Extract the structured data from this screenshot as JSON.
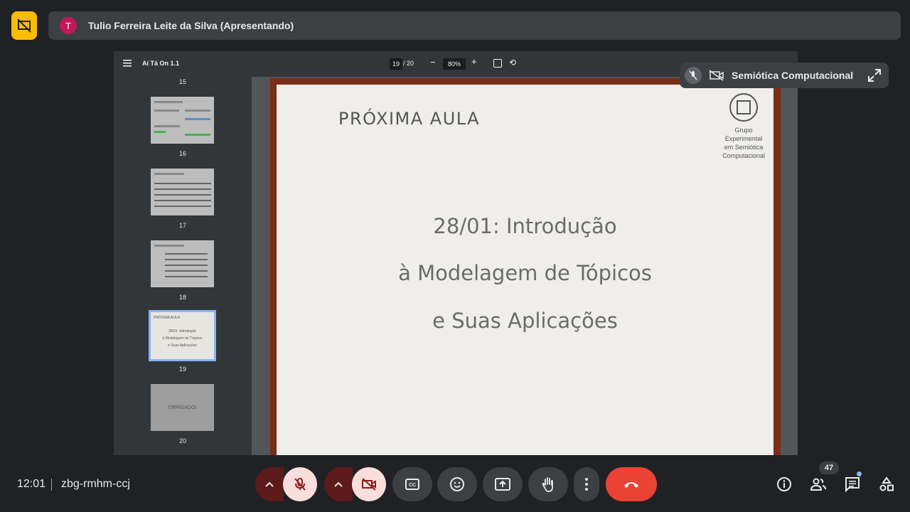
{
  "topbar": {
    "avatar_letter": "T",
    "presenter": "Tulio Ferreira Leite da Silva (Apresentando)"
  },
  "pdf": {
    "title": "Aí Tá On 1.1",
    "current_page": "19",
    "total_pages": "/ 20",
    "zoom": "80%",
    "zoom_minus": "−",
    "zoom_plus": "+",
    "thumbnails": [
      {
        "label": "15"
      },
      {
        "label": "16"
      },
      {
        "label": "17"
      },
      {
        "label": "18"
      },
      {
        "label": "19",
        "selected": true,
        "line1": "PRÓXIMA AULA",
        "line2": "28/01: Introdução",
        "line3": "à Modelagem de Tópicos",
        "line4": "e Suas Aplicações"
      },
      {
        "label": "20",
        "center": "OBRIGADO!"
      }
    ]
  },
  "slide": {
    "heading": "PRÓXIMA AULA",
    "line1": "28/01: Introdução",
    "line2": "à Modelagem de Tópicos",
    "line3": "e Suas Aplicações",
    "logo_lines": [
      "Grupo",
      "Experimental",
      "em Semiótica",
      "Computacional"
    ]
  },
  "pip": {
    "name": "Semiótica Computacional"
  },
  "footer": {
    "time": "12:01",
    "meeting_code": "zbg-rmhm-ccj",
    "participants_count": "47"
  },
  "colors": {
    "background": "#202124",
    "surface": "#3c4043",
    "present_accent": "#fbbc04",
    "end_call": "#ea4335",
    "muted_bg": "#f9dedc"
  }
}
